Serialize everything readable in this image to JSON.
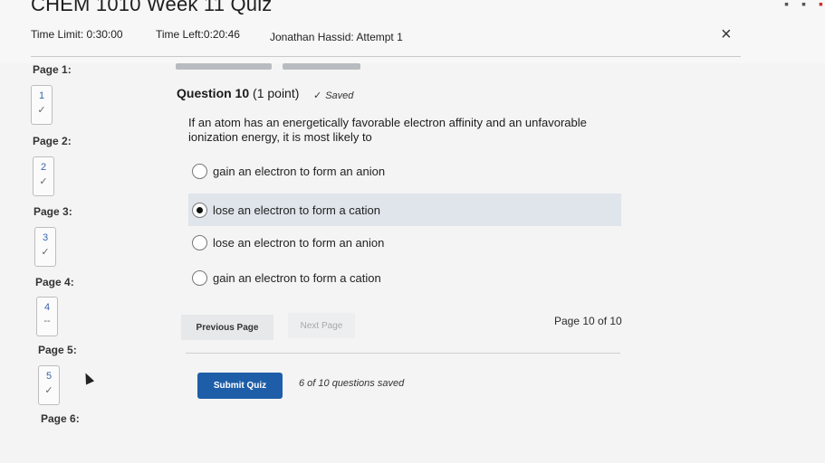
{
  "header": {
    "title": "CHEM 1010 Week 11 Quiz",
    "time_limit": "Time Limit: 0:30:00",
    "time_left": "Time Left:0:20:46",
    "attempt": "Jonathan Hassid: Attempt 1",
    "close_glyph": "×"
  },
  "sidebar": {
    "pages": [
      {
        "label": "Page 1:",
        "number": "1",
        "mark": "✓"
      },
      {
        "label": "Page 2:",
        "number": "2",
        "mark": "✓"
      },
      {
        "label": "Page 3:",
        "number": "3",
        "mark": "✓"
      },
      {
        "label": "Page 4:",
        "number": "4",
        "mark": "--"
      },
      {
        "label": "Page 5:",
        "number": "5",
        "mark": "✓"
      },
      {
        "label": "Page 6:"
      }
    ]
  },
  "question": {
    "heading": "Question 10",
    "points": "(1 point)",
    "saved_check": "✓",
    "saved_label": "Saved",
    "text": "If an atom has an energetically favorable electron affinity and an unfavorable ionization energy, it is most likely to",
    "options": [
      {
        "label": "gain an electron to form an anion",
        "selected": false
      },
      {
        "label": "lose an electron to form a cation",
        "selected": true
      },
      {
        "label": "lose an electron to form an anion",
        "selected": false
      },
      {
        "label": "gain an electron to form a cation",
        "selected": false
      }
    ]
  },
  "navigation": {
    "previous": "Previous Page",
    "next": "Next Page",
    "page_of": "Page 10 of 10"
  },
  "footer": {
    "submit": "Submit Quiz",
    "saved_count": "6 of 10 questions saved"
  },
  "colors": {
    "accent": "#1e5ea8",
    "selected_bg": "#dfe5eb",
    "background": "#f4f4f4"
  }
}
